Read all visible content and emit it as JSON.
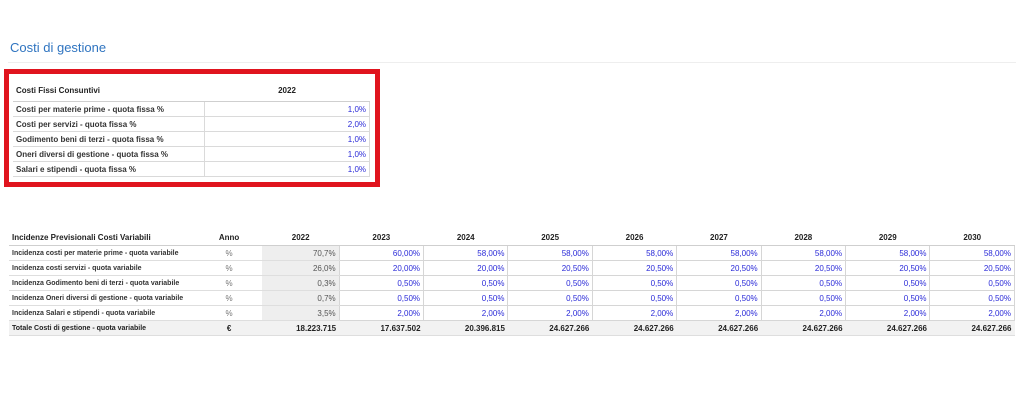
{
  "page_title": "Costi di gestione",
  "fixed": {
    "header_label": "Costi Fissi Consuntivi",
    "year": "2022",
    "rows": [
      {
        "label": "Costi per materie prime - quota fissa %",
        "value": "1,0%"
      },
      {
        "label": "Costi per servizi - quota fissa %",
        "value": "2,0%"
      },
      {
        "label": "Godimento beni di terzi - quota fissa %",
        "value": "1,0%"
      },
      {
        "label": "Oneri diversi di gestione - quota fissa %",
        "value": "1,0%"
      },
      {
        "label": "Salari e stipendi - quota fissa %",
        "value": "1,0%"
      }
    ]
  },
  "variable": {
    "header_label": "Incidenze Previsionali Costi Variabili",
    "unit_header": "Anno",
    "years": [
      "2022",
      "2023",
      "2024",
      "2025",
      "2026",
      "2027",
      "2028",
      "2029",
      "2030"
    ],
    "rows": [
      {
        "label": "Incidenza costi per materie prime - quota variabile",
        "unit": "%",
        "values": [
          "70,7%",
          "60,00%",
          "58,00%",
          "58,00%",
          "58,00%",
          "58,00%",
          "58,00%",
          "58,00%",
          "58,00%"
        ]
      },
      {
        "label": "Incidenza costi servizi - quota variabile",
        "unit": "%",
        "values": [
          "26,0%",
          "20,00%",
          "20,00%",
          "20,50%",
          "20,50%",
          "20,50%",
          "20,50%",
          "20,50%",
          "20,50%"
        ]
      },
      {
        "label": "Incidenza Godimento beni di terzi - quota variabile",
        "unit": "%",
        "values": [
          "0,3%",
          "0,50%",
          "0,50%",
          "0,50%",
          "0,50%",
          "0,50%",
          "0,50%",
          "0,50%",
          "0,50%"
        ]
      },
      {
        "label": "Incidenza Oneri diversi di gestione - quota variabile",
        "unit": "%",
        "values": [
          "0,7%",
          "0,50%",
          "0,50%",
          "0,50%",
          "0,50%",
          "0,50%",
          "0,50%",
          "0,50%",
          "0,50%"
        ]
      },
      {
        "label": "Incidenza Salari e stipendi - quota variabile",
        "unit": "%",
        "values": [
          "3,5%",
          "2,00%",
          "2,00%",
          "2,00%",
          "2,00%",
          "2,00%",
          "2,00%",
          "2,00%",
          "2,00%"
        ]
      }
    ],
    "total": {
      "label": "Totale Costi di gestione - quota variabile",
      "unit": "€",
      "values": [
        "18.223.715",
        "17.637.502",
        "20.396.815",
        "24.627.266",
        "24.627.266",
        "24.627.266",
        "24.627.266",
        "24.627.266",
        "24.627.266"
      ]
    }
  }
}
